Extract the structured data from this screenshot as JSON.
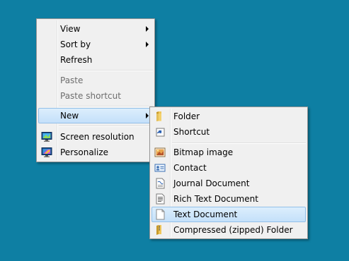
{
  "context_menu": {
    "items": [
      {
        "label": "View",
        "submenu": true,
        "disabled": false
      },
      {
        "label": "Sort by",
        "submenu": true,
        "disabled": false
      },
      {
        "label": "Refresh",
        "submenu": false,
        "disabled": false
      },
      {
        "label": "Paste",
        "submenu": false,
        "disabled": true
      },
      {
        "label": "Paste shortcut",
        "submenu": false,
        "disabled": true
      },
      {
        "label": "New",
        "submenu": true,
        "disabled": false,
        "highlighted": true
      },
      {
        "label": "Screen resolution",
        "icon": "screen-resolution-icon"
      },
      {
        "label": "Personalize",
        "icon": "personalize-icon"
      }
    ]
  },
  "new_submenu": {
    "items": [
      {
        "label": "Folder",
        "icon": "folder-icon"
      },
      {
        "label": "Shortcut",
        "icon": "shortcut-icon"
      },
      {
        "label": "Bitmap image",
        "icon": "bitmap-image-icon"
      },
      {
        "label": "Contact",
        "icon": "contact-icon"
      },
      {
        "label": "Journal Document",
        "icon": "journal-document-icon"
      },
      {
        "label": "Rich Text Document",
        "icon": "rich-text-document-icon"
      },
      {
        "label": "Text Document",
        "icon": "text-document-icon",
        "highlighted": true
      },
      {
        "label": "Compressed (zipped) Folder",
        "icon": "zipped-folder-icon"
      }
    ]
  },
  "colors": {
    "desktop": "#0e7fa3",
    "menu_bg": "#f0f0f0",
    "highlight_border": "#93c0e9",
    "highlight_bg": "#cfe6fb"
  }
}
